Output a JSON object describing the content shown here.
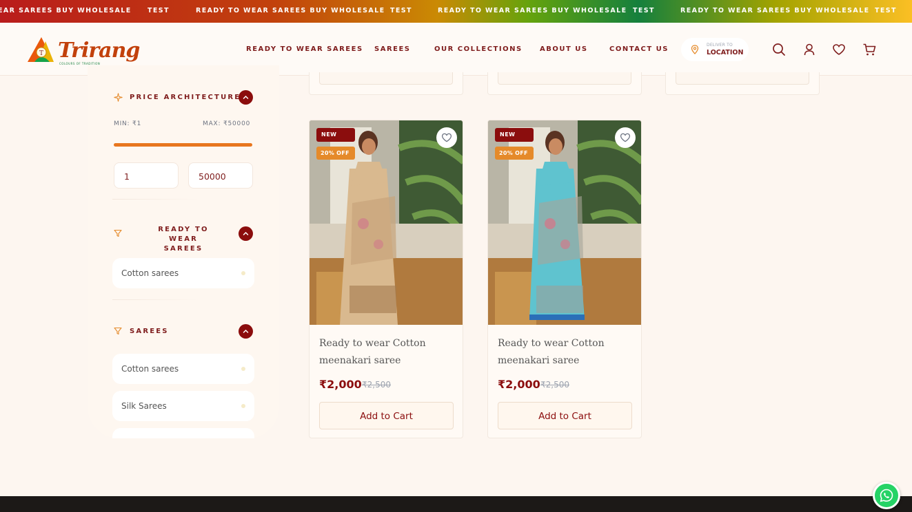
{
  "marquee": {
    "items": [
      "EAR SAREES BUY WHOLESALE",
      "TEST",
      "READY TO WEAR SAREES BUY WHOLESALE",
      "TEST",
      "READY TO WEAR SAREES BUY WHOLESALE",
      "TEST",
      "READY TO WEAR SAREES BUY WHOLESALE",
      "TEST"
    ]
  },
  "header": {
    "logo_text": "Trirang",
    "logo_tagline": "COLOURS OF TRADITION",
    "nav": [
      "READY TO WEAR SAREES",
      "SAREES",
      "OUR COLLECTIONS",
      "ABOUT US",
      "CONTACT US"
    ],
    "deliver_label": "DELIVER TO",
    "location_label": "LOCATION",
    "icons": [
      "search-icon",
      "user-icon",
      "heart-icon",
      "cart-icon"
    ]
  },
  "sidebar": {
    "price": {
      "title": "PRICE ARCHITECTURE",
      "min_label": "MIN: ₹1",
      "max_label": "MAX: ₹50000",
      "min_value": "1",
      "max_value": "50000",
      "range_fill_fraction": 1.0
    },
    "ready_to_wear": {
      "title_line1": "READY TO WEAR",
      "title_line2": "SAREES",
      "items": [
        "Cotton sarees"
      ]
    },
    "sarees": {
      "title": "SAREES",
      "items": [
        "Cotton sarees",
        "Silk Sarees"
      ]
    }
  },
  "products": [
    {
      "badge_new": "NEW",
      "badge_off": "20% OFF",
      "name": "Ready to wear Cotton meenakari saree",
      "price": "₹2,000",
      "old_price": "₹2,500",
      "cart_label": "Add to Cart",
      "saree_color": "#d9b98f"
    },
    {
      "badge_new": "NEW",
      "badge_off": "20% OFF",
      "name": "Ready to wear Cotton meenakari saree",
      "price": "₹2,000",
      "old_price": "₹2,500",
      "cart_label": "Add to Cart",
      "saree_color": "#5fc3cf"
    }
  ],
  "colors": {
    "brand_maroon": "#8b0d0d",
    "accent_orange": "#e8761e",
    "background": "#fdf6f0"
  }
}
